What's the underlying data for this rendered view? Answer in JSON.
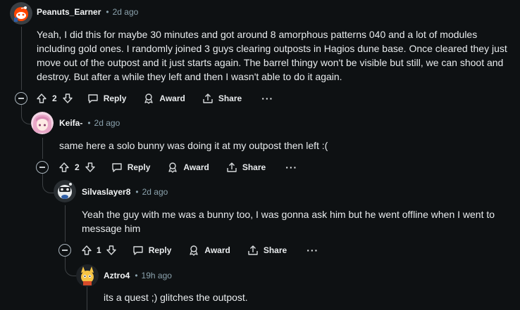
{
  "comments": [
    {
      "author": "Peanuts_Earner",
      "separator": "•",
      "time": "2d ago",
      "body": [
        "Yeah, I did this for maybe 30 minutes and got around 8 amorphous patterns 040 and a lot of modules",
        "including gold ones. I randomly joined 3 guys clearing outposts in Hagios dune base. Once cleared they just",
        "move out of the outpost and it just starts again. The barrel thingy won't be visible but still, we can shoot and",
        "destroy. But after a while they left and then I wasn't able to do it again."
      ],
      "votes": "2",
      "reply_label": "Reply",
      "award_label": "Award",
      "share_label": "Share",
      "more_label": "···"
    },
    {
      "author": "Keifa-",
      "separator": "•",
      "time": "2d ago",
      "body": [
        "same here a solo bunny was doing it at my outpost then left :("
      ],
      "votes": "2",
      "reply_label": "Reply",
      "award_label": "Award",
      "share_label": "Share",
      "more_label": "···"
    },
    {
      "author": "Silvaslayer8",
      "separator": "•",
      "time": "2d ago",
      "body": [
        "Yeah the guy with me was a bunny too, I was gonna ask him but he went offline when I went to",
        "message him"
      ],
      "votes": "1",
      "reply_label": "Reply",
      "award_label": "Award",
      "share_label": "Share",
      "more_label": "···"
    },
    {
      "author": "Aztro4",
      "separator": "•",
      "time": "19h ago",
      "body": [
        "its a quest ;) glitches the outpost."
      ]
    }
  ]
}
